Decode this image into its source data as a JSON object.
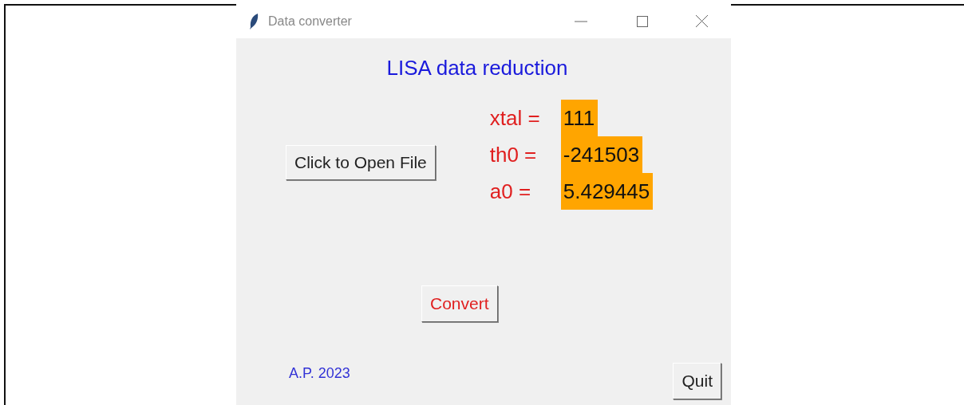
{
  "window": {
    "title": "Data converter"
  },
  "heading": "LISA data reduction",
  "open_button": "Click to Open File",
  "fields": [
    {
      "label": "xtal =",
      "value": "111"
    },
    {
      "label": "th0 =",
      "value": "-241503"
    },
    {
      "label": "a0 =",
      "value": "5.429445"
    }
  ],
  "convert_button": "Convert",
  "footer": "A.P. 2023",
  "quit_button": "Quit"
}
